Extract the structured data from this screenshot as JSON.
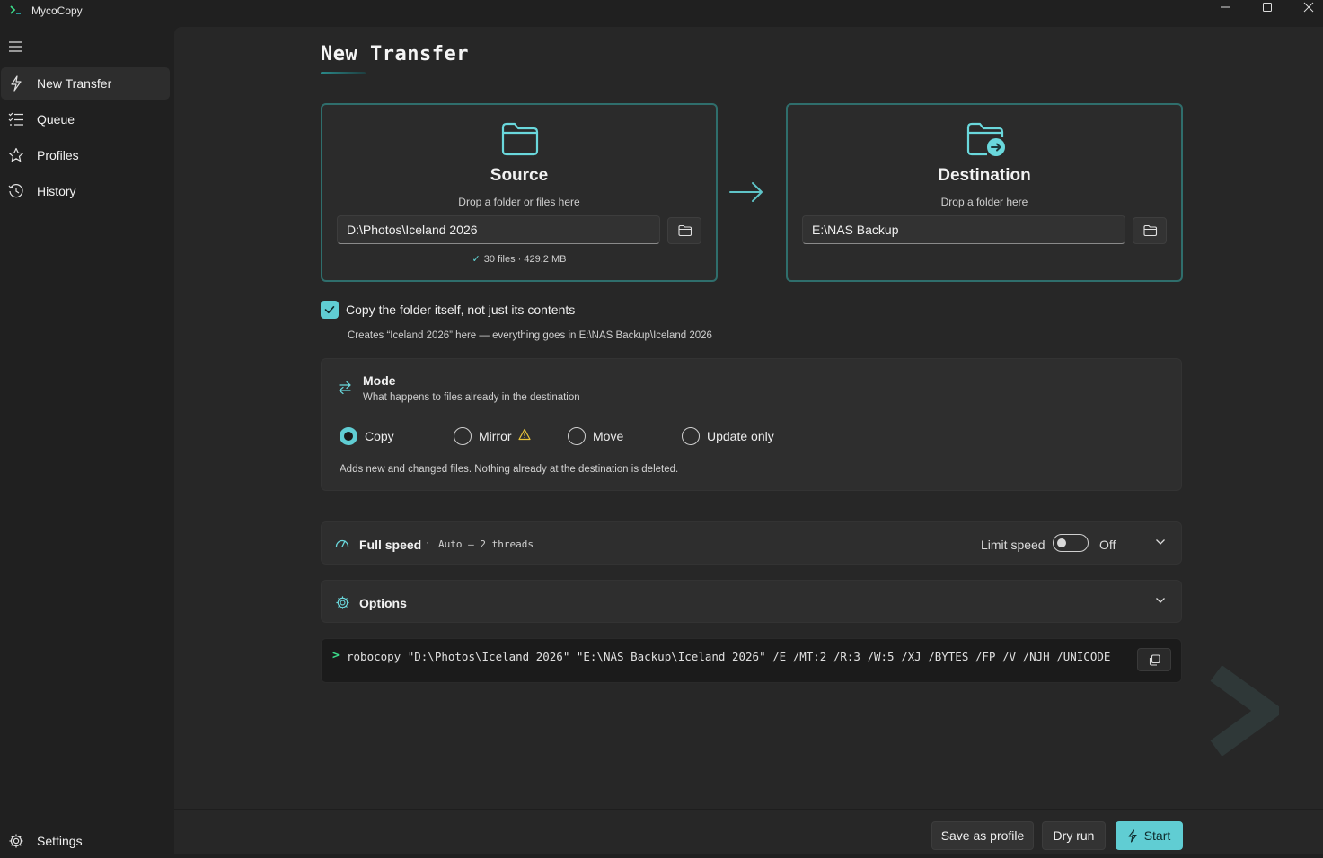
{
  "app": {
    "title": "MycoCopy"
  },
  "sidebar": {
    "items": [
      {
        "label": "New Transfer"
      },
      {
        "label": "Queue"
      },
      {
        "label": "Profiles"
      },
      {
        "label": "History"
      }
    ],
    "settings_label": "Settings"
  },
  "page": {
    "title": "New Transfer"
  },
  "source": {
    "title": "Source",
    "hint": "Drop a folder or files here",
    "path": "D:\\Photos\\Iceland 2026",
    "stats": "30 files · 429.2 MB"
  },
  "destination": {
    "title": "Destination",
    "hint": "Drop a folder here",
    "path": "E:\\NAS Backup"
  },
  "copy_folder": {
    "checked": true,
    "label": "Copy the folder itself, not just its contents",
    "hint": "Creates “Iceland 2026” here — everything goes in E:\\NAS Backup\\Iceland 2026"
  },
  "mode": {
    "title": "Mode",
    "subtitle": "What happens to files already in the destination",
    "options": [
      {
        "label": "Copy",
        "selected": true
      },
      {
        "label": "Mirror",
        "warning": true
      },
      {
        "label": "Move"
      },
      {
        "label": "Update only"
      }
    ],
    "description": "Adds new and changed files. Nothing already at the destination is deleted."
  },
  "speed": {
    "title": "Full speed",
    "separator": "·",
    "detail": "Auto — 2 threads",
    "limit_label": "Limit speed",
    "limit_state": "Off"
  },
  "options": {
    "title": "Options"
  },
  "command": {
    "prompt": ">",
    "text": "robocopy \"D:\\Photos\\Iceland 2026\" \"E:\\NAS Backup\\Iceland 2026\" /E /MT:2 /R:3 /W:5 /XJ /BYTES /FP /V /NJH /UNICODE"
  },
  "footer": {
    "save_profile": "Save as profile",
    "dry_run": "Dry run",
    "start": "Start"
  },
  "colors": {
    "accent": "#60cdd3",
    "card_border": "#2f6e6c",
    "warning": "#e8c43a"
  }
}
